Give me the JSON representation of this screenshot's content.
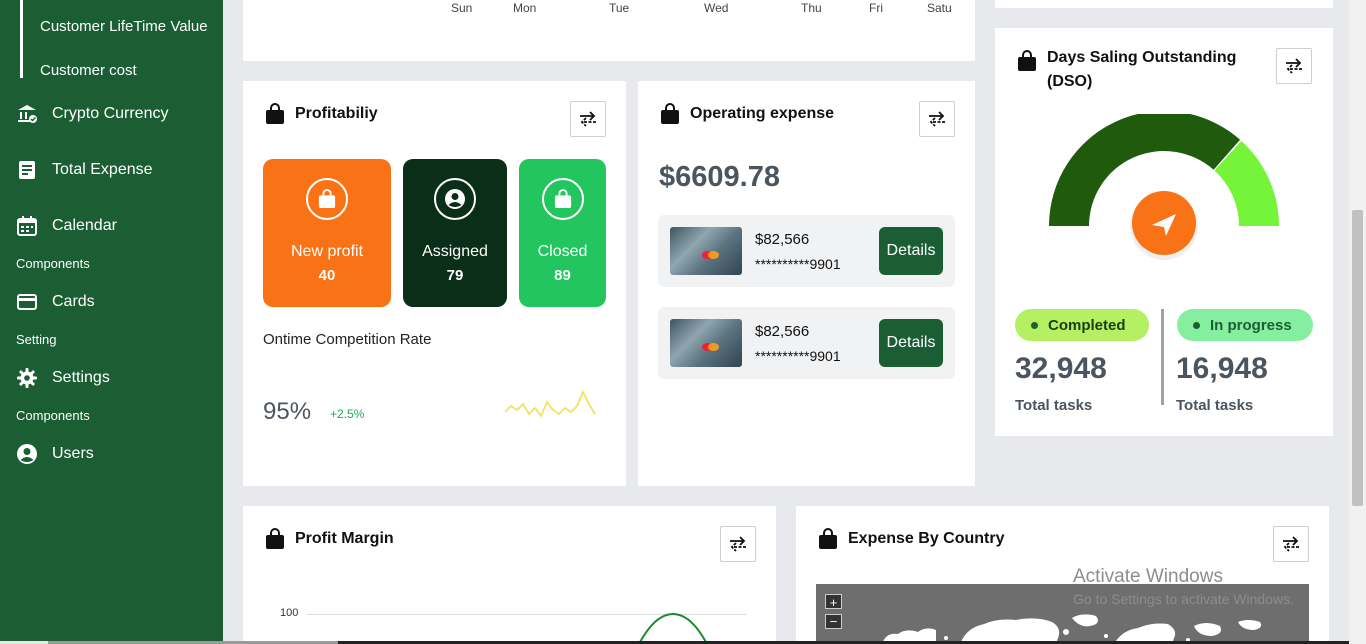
{
  "sidebar": {
    "sub_items": [
      "Customer LifeTime Value",
      "Customer cost"
    ],
    "items": [
      {
        "label": "Crypto Currency",
        "icon": "bank-icon"
      },
      {
        "label": "Total Expense",
        "icon": "document-icon"
      },
      {
        "label": "Calendar",
        "icon": "calendar-icon"
      },
      {
        "label": "Cards",
        "icon": "credit-card-icon"
      },
      {
        "label": "Settings",
        "icon": "gear-icon"
      },
      {
        "label": "Users",
        "icon": "user-circle-icon"
      }
    ],
    "sections": [
      "Components",
      "Setting",
      "Components"
    ]
  },
  "weekly": {
    "days": [
      "Sun",
      "Mon",
      "Tue",
      "Wed",
      "Thu",
      "Fri",
      "Satu"
    ]
  },
  "profitability": {
    "title": "Profitabiliy",
    "tiles": [
      {
        "label": "New profit",
        "value": "40",
        "color": "#f97316"
      },
      {
        "label": "Assigned",
        "value": "79",
        "color": "#0b2e18"
      },
      {
        "label": "Closed",
        "value": "89",
        "color": "#22c55e"
      }
    ],
    "rate_label": "Ontime Competition Rate",
    "rate_value": "95%",
    "rate_change": "+2.5%"
  },
  "operating": {
    "title": "Operating expense",
    "total": "$6609.78",
    "rows": [
      {
        "amount": "$82,566",
        "number": "**********9901",
        "button": "Details"
      },
      {
        "amount": "$82,566",
        "number": "**********9901",
        "button": "Details"
      }
    ]
  },
  "dso": {
    "title_line1": "Days Saling Outstanding",
    "title_line2": "(DSO)",
    "gauge_fraction": 0.73,
    "completed": {
      "label": "Completed",
      "value": "32,948",
      "sub": "Total tasks"
    },
    "in_progress": {
      "label": "In progress",
      "value": "16,948",
      "sub": "Total tasks"
    }
  },
  "profit_margin": {
    "title": "Profit Margin",
    "y_tick": "100"
  },
  "expense_country": {
    "title": "Expense By Country",
    "zoom_in": "+",
    "zoom_out": "−"
  },
  "watermark": {
    "line1": "Activate Windows",
    "line2": "Go to Settings to activate Windows."
  },
  "colors": {
    "sidebar": "#1b5e34",
    "accent_orange": "#f97316",
    "accent_green": "#22c55e",
    "gauge_dark": "#1f5a0d",
    "gauge_light": "#76f43a"
  }
}
